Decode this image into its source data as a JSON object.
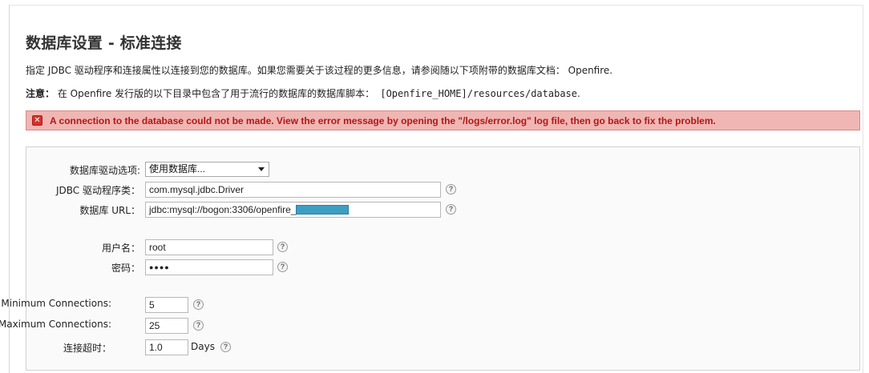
{
  "page": {
    "title": "数据库设置 - 标准连接",
    "intro": "指定 JDBC 驱动程序和连接属性以连接到您的数据库。如果您需要关于该过程的更多信息，请参阅随以下项附带的数据库文档： Openfire.",
    "note_label": "注意：",
    "note_text": " 在 Openfire 发行版的以下目录中包含了用于流行的数据库的数据库脚本：",
    "note_path": " [Openfire_HOME]/resources/database",
    "note_end": "."
  },
  "error": {
    "icon": "error-x-icon",
    "message": "A connection to the database could not be made. View the error message by opening the \"/logs/error.log\" log file, then go back to fix the problem."
  },
  "form": {
    "driver_preset": {
      "label": "数据库驱动选项:",
      "selected": "使用数据库..."
    },
    "jdbc_class": {
      "label": "JDBC 驱动程序类：",
      "value": "com.mysql.jdbc.Driver"
    },
    "db_url": {
      "label": "数据库 URL：",
      "value": "jdbc:mysql://bogon:3306/openfire_"
    },
    "username": {
      "label": "用户名：",
      "value": "root"
    },
    "password": {
      "label": "密码：",
      "value": "●●●●"
    },
    "min_conn": {
      "label": "Minimum Connections:",
      "value": "5"
    },
    "max_conn": {
      "label": "Maximum Connections:",
      "value": "25"
    },
    "timeout": {
      "label": "连接超时：",
      "value": "1.0",
      "unit": "Days"
    },
    "help_glyph": "?"
  },
  "colors": {
    "error_bg": "#f0b6b3",
    "error_text": "#b01818",
    "redaction": "#3c9fc1"
  }
}
